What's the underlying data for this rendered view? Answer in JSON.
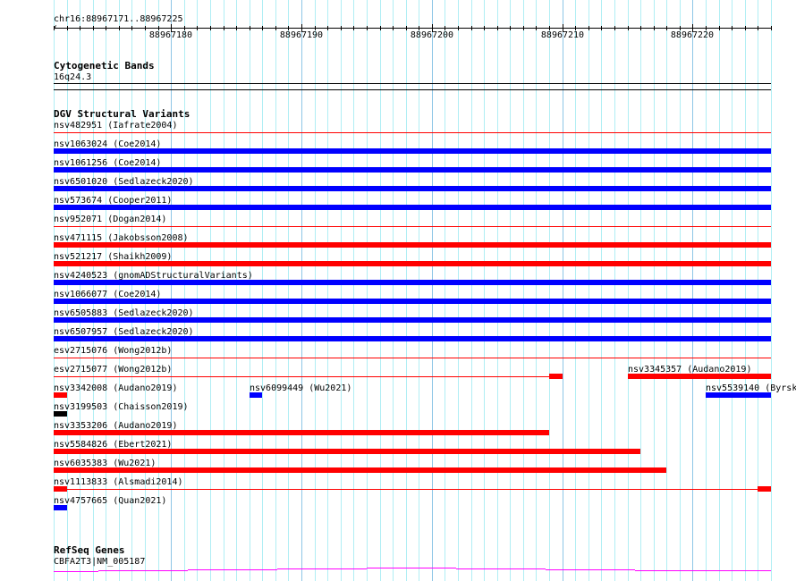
{
  "ruler": {
    "location": "chr16:88967171..88967225",
    "start": 88967171,
    "end": 88967226,
    "labels": [
      "88967180",
      "88967190",
      "88967200",
      "88967210",
      "88967220"
    ]
  },
  "cyto": {
    "title": "Cytogenetic Bands",
    "band": "16q24.3"
  },
  "dgv": {
    "title": "DGV Structural Variants",
    "colors": {
      "red": "#ff0000",
      "blue": "#0000ff",
      "black": "#000000"
    },
    "rows": [
      [
        {
          "label": "nsv482951 (Iafrate2004)",
          "color": "red",
          "style": "thin",
          "start": 88967171,
          "end": 88967226
        }
      ],
      [
        {
          "label": "nsv1063024 (Coe2014)",
          "color": "blue",
          "style": "thick",
          "start": 88967171,
          "end": 88967226
        }
      ],
      [
        {
          "label": "nsv1061256 (Coe2014)",
          "color": "blue",
          "style": "thick",
          "start": 88967171,
          "end": 88967226
        }
      ],
      [
        {
          "label": "nsv6501020 (Sedlazeck2020)",
          "color": "blue",
          "style": "thick",
          "start": 88967171,
          "end": 88967226
        }
      ],
      [
        {
          "label": "nsv573674 (Cooper2011)",
          "color": "blue",
          "style": "thick",
          "start": 88967171,
          "end": 88967226
        }
      ],
      [
        {
          "label": "nsv952071 (Dogan2014)",
          "color": "red",
          "style": "thin",
          "start": 88967171,
          "end": 88967226
        }
      ],
      [
        {
          "label": "nsv471115 (Jakobsson2008)",
          "color": "red",
          "style": "thick",
          "start": 88967171,
          "end": 88967226
        }
      ],
      [
        {
          "label": "nsv521217 (Shaikh2009)",
          "color": "red",
          "style": "thick",
          "start": 88967171,
          "end": 88967226
        }
      ],
      [
        {
          "label": "nsv4240523 (gnomADStructuralVariants)",
          "color": "blue",
          "style": "thick",
          "start": 88967171,
          "end": 88967226
        }
      ],
      [
        {
          "label": "nsv1066077 (Coe2014)",
          "color": "blue",
          "style": "thick",
          "start": 88967171,
          "end": 88967226
        }
      ],
      [
        {
          "label": "nsv6505883 (Sedlazeck2020)",
          "color": "blue",
          "style": "thick",
          "start": 88967171,
          "end": 88967226
        }
      ],
      [
        {
          "label": "nsv6507957 (Sedlazeck2020)",
          "color": "blue",
          "style": "thick",
          "start": 88967171,
          "end": 88967226
        }
      ],
      [
        {
          "label": "esv2715076 (Wong2012b)",
          "color": "red",
          "style": "thin",
          "start": 88967171,
          "end": 88967226
        }
      ],
      [
        {
          "label": "esv2715077 (Wong2012b)",
          "color": "red",
          "style": "thin",
          "start": 88967171,
          "end": 88967209,
          "blocks": [
            [
              88967209,
              88967210
            ]
          ]
        },
        {
          "label": "nsv3345357 (Audano2019)",
          "color": "red",
          "style": "thick",
          "start": 88967215,
          "end": 88967226
        }
      ],
      [
        {
          "label": "nsv3342008 (Audano2019)",
          "color": "red",
          "style": "thick",
          "start": 88967171,
          "end": 88967172
        },
        {
          "label": "nsv6099449 (Wu2021)",
          "color": "blue",
          "style": "thick",
          "start": 88967186,
          "end": 88967187
        },
        {
          "label": "nsv5539140 (Byrska",
          "color": "blue",
          "style": "thick",
          "start": 88967221,
          "end": 88967226
        }
      ],
      [
        {
          "label": "nsv3199503 (Chaisson2019)",
          "color": "black",
          "style": "thick",
          "start": 88967171,
          "end": 88967172
        }
      ],
      [
        {
          "label": "nsv3353206 (Audano2019)",
          "color": "red",
          "style": "thick",
          "start": 88967171,
          "end": 88967209
        }
      ],
      [
        {
          "label": "nsv5584826 (Ebert2021)",
          "color": "red",
          "style": "thick",
          "start": 88967171,
          "end": 88967216
        }
      ],
      [
        {
          "label": "nsv6035383 (Wu2021)",
          "color": "red",
          "style": "thick",
          "start": 88967171,
          "end": 88967218
        }
      ],
      [
        {
          "label": "nsv1113833 (Alsmadi2014)",
          "color": "red",
          "style": "thin",
          "start": 88967171,
          "end": 88967226,
          "blocks": [
            [
              88967171,
              88967172
            ],
            [
              88967225,
              88967226
            ]
          ]
        }
      ],
      [
        {
          "label": "nsv4757665 (Quan2021)",
          "color": "blue",
          "style": "thick",
          "start": 88967171,
          "end": 88967172
        }
      ]
    ]
  },
  "refseq": {
    "title": "RefSeq Genes",
    "gene": "CBFA2T3|NM_005187",
    "color": "#ff00ff"
  }
}
